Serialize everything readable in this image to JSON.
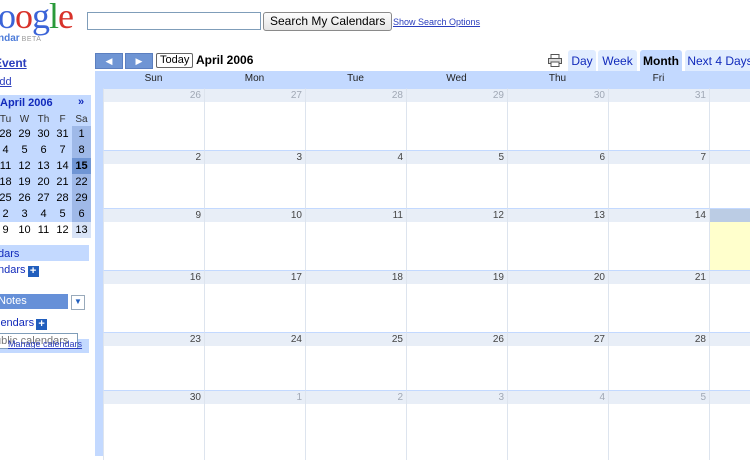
{
  "header": {
    "logo_letters": [
      {
        "ch": "o",
        "color": "#3b64d8"
      },
      {
        "ch": "o",
        "color": "#d8322a"
      },
      {
        "ch": "g",
        "color": "#3b64d8"
      },
      {
        "ch": "l",
        "color": "#2a9a3a"
      },
      {
        "ch": "e",
        "color": "#d8322a"
      }
    ],
    "logo_sub": "ndar",
    "logo_beta": "BETA",
    "search_value": "",
    "search_button": "Search My Calendars",
    "search_options": "Show Search Options"
  },
  "sidebar": {
    "create_event": "Event",
    "quick_add": "Add",
    "mini_cal": {
      "title": "April 2006",
      "next": "»",
      "dow": [
        "Tu",
        "W",
        "Th",
        "F",
        "Sa"
      ],
      "weeks": [
        [
          "28",
          "29",
          "30",
          "31",
          "1"
        ],
        [
          "4",
          "5",
          "6",
          "7",
          "8"
        ],
        [
          "11",
          "12",
          "13",
          "14",
          "15"
        ],
        [
          "18",
          "19",
          "20",
          "21",
          "22"
        ],
        [
          "25",
          "26",
          "27",
          "28",
          "29"
        ],
        [
          "2",
          "3",
          "4",
          "5",
          "6"
        ],
        [
          "9",
          "10",
          "11",
          "12",
          "13"
        ]
      ]
    },
    "panel_title": "dars",
    "my_calendars": "ndars",
    "calendar_entry": "Notes",
    "other_calendars": "lendars",
    "public_placeholder": "ublic calendars",
    "manage": "Manage calendars"
  },
  "toolbar": {
    "prev_glyph": "◀",
    "next_glyph": "▶",
    "today": "Today",
    "title": "April 2006",
    "views": [
      "Day",
      "Week",
      "Month",
      "Next 4 Days"
    ],
    "active_view": "Month"
  },
  "grid": {
    "dow": [
      "Sun",
      "Mon",
      "Tue",
      "Wed",
      "Thu",
      "Fri"
    ],
    "weeks": [
      [
        {
          "d": "26",
          "other": true
        },
        {
          "d": "27",
          "other": true
        },
        {
          "d": "28",
          "other": true
        },
        {
          "d": "29",
          "other": true
        },
        {
          "d": "30",
          "other": true
        },
        {
          "d": "31",
          "other": true
        },
        {
          "d": "",
          "other": true
        }
      ],
      [
        {
          "d": "2"
        },
        {
          "d": "3"
        },
        {
          "d": "4"
        },
        {
          "d": "5"
        },
        {
          "d": "6"
        },
        {
          "d": "7"
        },
        {
          "d": ""
        }
      ],
      [
        {
          "d": "9"
        },
        {
          "d": "10"
        },
        {
          "d": "11"
        },
        {
          "d": "12"
        },
        {
          "d": "13"
        },
        {
          "d": "14"
        },
        {
          "d": "",
          "today": true
        }
      ],
      [
        {
          "d": "16"
        },
        {
          "d": "17"
        },
        {
          "d": "18"
        },
        {
          "d": "19"
        },
        {
          "d": "20"
        },
        {
          "d": "21"
        },
        {
          "d": ""
        }
      ],
      [
        {
          "d": "23"
        },
        {
          "d": "24"
        },
        {
          "d": "25"
        },
        {
          "d": "26"
        },
        {
          "d": "27"
        },
        {
          "d": "28"
        },
        {
          "d": ""
        }
      ],
      [
        {
          "d": "30"
        },
        {
          "d": "1",
          "other": true
        },
        {
          "d": "2",
          "other": true
        },
        {
          "d": "3",
          "other": true
        },
        {
          "d": "4",
          "other": true
        },
        {
          "d": "5",
          "other": true
        },
        {
          "d": "",
          "other": true
        }
      ]
    ]
  },
  "colors": {
    "accent": "#c3d9ff",
    "link": "#2a3dbd",
    "today_highlight": "#ffffcc"
  }
}
